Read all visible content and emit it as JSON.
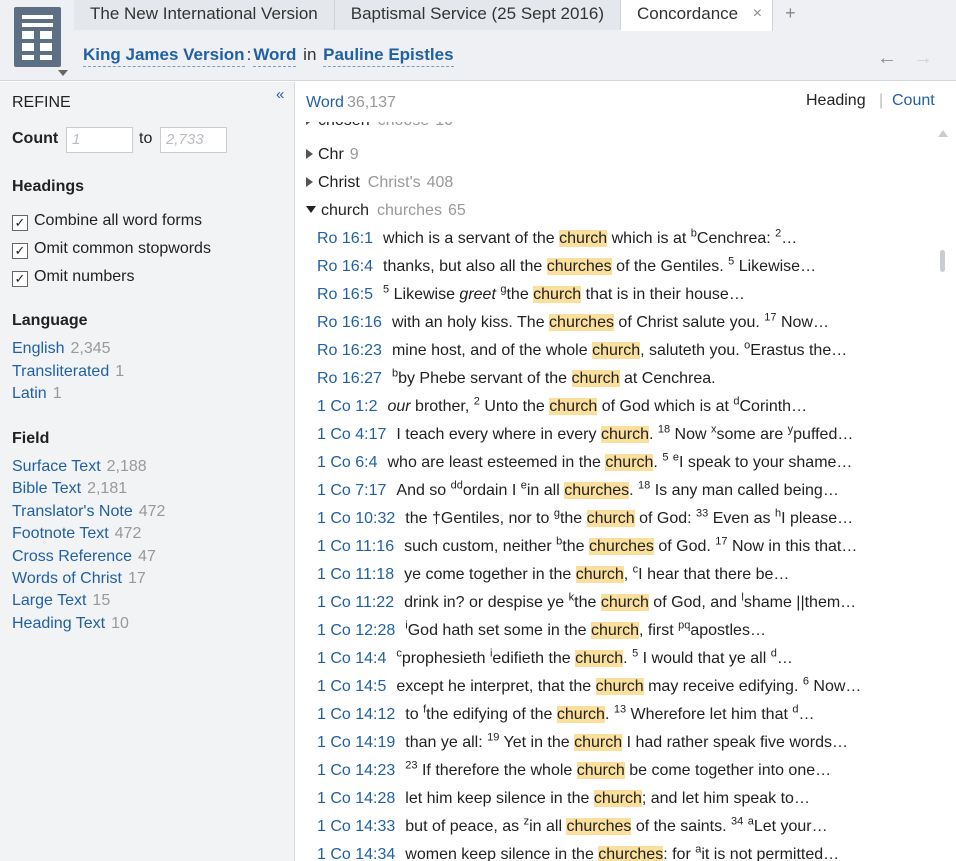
{
  "tabs": [
    {
      "label": "The New International Version"
    },
    {
      "label": "Baptismal Service (25 Sept 2016)"
    },
    {
      "label": "Concordance",
      "close": "×"
    }
  ],
  "tab_add": "+",
  "breadcrumb": {
    "version": "King James Version",
    "colon": ":",
    "field": "Word",
    "in": "in",
    "scope": "Pauline Epistles"
  },
  "nav": {
    "back": "←",
    "forward": "→"
  },
  "sidebar": {
    "collapse": "«",
    "refine": "REFINE",
    "count_label": "Count",
    "count_min_placeholder": "1",
    "count_to": "to",
    "count_max_placeholder": "2,733",
    "headings_title": "Headings",
    "checks": [
      {
        "label": "Combine all word forms",
        "checked": "✓"
      },
      {
        "label": "Omit common stopwords",
        "checked": "✓"
      },
      {
        "label": "Omit numbers",
        "checked": "✓"
      }
    ],
    "language_title": "Language",
    "languages": [
      {
        "label": "English",
        "count": "2,345"
      },
      {
        "label": "Transliterated",
        "count": "1"
      },
      {
        "label": "Latin",
        "count": "1"
      }
    ],
    "field_title": "Field",
    "fields": [
      {
        "label": "Surface Text",
        "count": "2,188"
      },
      {
        "label": "Bible Text",
        "count": "2,181"
      },
      {
        "label": "Translator's Note",
        "count": "472"
      },
      {
        "label": "Footnote Text",
        "count": "472"
      },
      {
        "label": "Cross Reference",
        "count": "47"
      },
      {
        "label": "Words of Christ",
        "count": "17"
      },
      {
        "label": "Large Text",
        "count": "15"
      },
      {
        "label": "Heading Text",
        "count": "10"
      }
    ]
  },
  "main": {
    "title": "Word",
    "total": "36,137",
    "view_heading": "Heading",
    "view_sep": "|",
    "view_count": "Count",
    "words": [
      {
        "word": "chosen",
        "form": "choose",
        "count": "10"
      },
      {
        "word": "Chr",
        "form": "",
        "count": "9"
      },
      {
        "word": "Christ",
        "form": "Christ's",
        "count": "408"
      },
      {
        "word": "church",
        "form": "churches",
        "count": "65"
      }
    ],
    "verses": [
      {
        "ref": "Ro 16:1",
        "segs": [
          {
            "t": "which is a servant of the "
          },
          {
            "t": "church",
            "h": 1
          },
          {
            "t": " which is at "
          },
          {
            "t": "b",
            "s": 1
          },
          {
            "t": "Cenchrea: "
          },
          {
            "t": "2",
            "s": 1
          },
          {
            "t": "…"
          }
        ]
      },
      {
        "ref": "Ro 16:4",
        "segs": [
          {
            "t": "thanks, but also all the "
          },
          {
            "t": "churches",
            "h": 1
          },
          {
            "t": " of the Gentiles. "
          },
          {
            "t": "5",
            "s": 1
          },
          {
            "t": " Likewise…"
          }
        ]
      },
      {
        "ref": "Ro 16:5",
        "segs": [
          {
            "t": "5",
            "s": 1
          },
          {
            "t": " Likewise "
          },
          {
            "t": "greet",
            "i": 1
          },
          {
            "t": " "
          },
          {
            "t": "g",
            "s": 1
          },
          {
            "t": "the "
          },
          {
            "t": "church",
            "h": 1
          },
          {
            "t": " that is in their house…"
          }
        ]
      },
      {
        "ref": "Ro 16:16",
        "segs": [
          {
            "t": "with an holy kiss. The "
          },
          {
            "t": "churches",
            "h": 1
          },
          {
            "t": " of Christ salute you. "
          },
          {
            "t": "17",
            "s": 1
          },
          {
            "t": " Now…"
          }
        ]
      },
      {
        "ref": "Ro 16:23",
        "segs": [
          {
            "t": "mine host, and of the whole "
          },
          {
            "t": "church",
            "h": 1
          },
          {
            "t": ", saluteth you. "
          },
          {
            "t": "o",
            "s": 1
          },
          {
            "t": "Erastus the…"
          }
        ]
      },
      {
        "ref": "Ro 16:27",
        "segs": [
          {
            "t": "b",
            "s": 1
          },
          {
            "t": "by Phebe servant of the "
          },
          {
            "t": "church",
            "h": 1
          },
          {
            "t": " at Cenchrea."
          }
        ]
      },
      {
        "ref": "1 Co 1:2",
        "segs": [
          {
            "t": "our",
            "i": 1
          },
          {
            "t": " brother, "
          },
          {
            "t": "2",
            "s": 1
          },
          {
            "t": " Unto the "
          },
          {
            "t": "church",
            "h": 1
          },
          {
            "t": " of God which is at "
          },
          {
            "t": "d",
            "s": 1
          },
          {
            "t": "Corinth…"
          }
        ]
      },
      {
        "ref": "1 Co 4:17",
        "segs": [
          {
            "t": "I teach every where in every "
          },
          {
            "t": "church",
            "h": 1
          },
          {
            "t": ". "
          },
          {
            "t": "18",
            "s": 1
          },
          {
            "t": " Now "
          },
          {
            "t": "x",
            "s": 1
          },
          {
            "t": "some are "
          },
          {
            "t": "y",
            "s": 1
          },
          {
            "t": "puffed…"
          }
        ]
      },
      {
        "ref": "1 Co 6:4",
        "segs": [
          {
            "t": "who are least esteemed in the "
          },
          {
            "t": "church",
            "h": 1
          },
          {
            "t": ". "
          },
          {
            "t": "5",
            "s": 1
          },
          {
            "t": " "
          },
          {
            "t": "e",
            "s": 1
          },
          {
            "t": "I speak to your shame…"
          }
        ]
      },
      {
        "ref": "1 Co 7:17",
        "segs": [
          {
            "t": "And so "
          },
          {
            "t": "dd",
            "s": 1
          },
          {
            "t": "ordain I "
          },
          {
            "t": "e",
            "s": 1
          },
          {
            "t": "in all "
          },
          {
            "t": "churches",
            "h": 1
          },
          {
            "t": ". "
          },
          {
            "t": "18",
            "s": 1
          },
          {
            "t": " Is any man called being…"
          }
        ]
      },
      {
        "ref": "1 Co 10:32",
        "segs": [
          {
            "t": "the †Gentiles, nor to "
          },
          {
            "t": "g",
            "s": 1
          },
          {
            "t": "the "
          },
          {
            "t": "church",
            "h": 1
          },
          {
            "t": " of God: "
          },
          {
            "t": "33",
            "s": 1
          },
          {
            "t": " Even as "
          },
          {
            "t": "h",
            "s": 1
          },
          {
            "t": "I please…"
          }
        ]
      },
      {
        "ref": "1 Co 11:16",
        "segs": [
          {
            "t": "such custom, neither "
          },
          {
            "t": "b",
            "s": 1
          },
          {
            "t": "the "
          },
          {
            "t": "churches",
            "h": 1
          },
          {
            "t": " of God. "
          },
          {
            "t": "17",
            "s": 1
          },
          {
            "t": " Now in this that…"
          }
        ]
      },
      {
        "ref": "1 Co 11:18",
        "segs": [
          {
            "t": "ye come together in the "
          },
          {
            "t": "church",
            "h": 1
          },
          {
            "t": ", "
          },
          {
            "t": "c",
            "s": 1
          },
          {
            "t": "I hear that there be…"
          }
        ]
      },
      {
        "ref": "1 Co 11:22",
        "segs": [
          {
            "t": "drink in? or despise ye "
          },
          {
            "t": "k",
            "s": 1
          },
          {
            "t": "the "
          },
          {
            "t": "church",
            "h": 1
          },
          {
            "t": " of God, and "
          },
          {
            "t": "l",
            "s": 1
          },
          {
            "t": "shame ||them…"
          }
        ]
      },
      {
        "ref": "1 Co 12:28",
        "segs": [
          {
            "t": "i",
            "s": 1
          },
          {
            "t": "God hath set some in the "
          },
          {
            "t": "church",
            "h": 1
          },
          {
            "t": ", first "
          },
          {
            "t": "pq",
            "s": 1
          },
          {
            "t": "apostles…"
          }
        ]
      },
      {
        "ref": "1 Co 14:4",
        "segs": [
          {
            "t": "c",
            "s": 1
          },
          {
            "t": "prophesieth "
          },
          {
            "t": "i",
            "s": 1
          },
          {
            "t": "edifieth the "
          },
          {
            "t": "church",
            "h": 1
          },
          {
            "t": ". "
          },
          {
            "t": "5",
            "s": 1
          },
          {
            "t": " I would that ye all "
          },
          {
            "t": "d",
            "s": 1
          },
          {
            "t": "…"
          }
        ]
      },
      {
        "ref": "1 Co 14:5",
        "segs": [
          {
            "t": "except he interpret, that the "
          },
          {
            "t": "church",
            "h": 1
          },
          {
            "t": " may receive edifying. "
          },
          {
            "t": "6",
            "s": 1
          },
          {
            "t": " Now…"
          }
        ]
      },
      {
        "ref": "1 Co 14:12",
        "segs": [
          {
            "t": "to "
          },
          {
            "t": "f",
            "s": 1
          },
          {
            "t": "the edifying of the "
          },
          {
            "t": "church",
            "h": 1
          },
          {
            "t": ". "
          },
          {
            "t": "13",
            "s": 1
          },
          {
            "t": " Wherefore let him that "
          },
          {
            "t": "d",
            "s": 1
          },
          {
            "t": "…"
          }
        ]
      },
      {
        "ref": "1 Co 14:19",
        "segs": [
          {
            "t": "than ye all: "
          },
          {
            "t": "19",
            "s": 1
          },
          {
            "t": " Yet in the "
          },
          {
            "t": "church",
            "h": 1
          },
          {
            "t": " I had rather speak five words…"
          }
        ]
      },
      {
        "ref": "1 Co 14:23",
        "segs": [
          {
            "t": "23",
            "s": 1
          },
          {
            "t": " If therefore the whole "
          },
          {
            "t": "church",
            "h": 1
          },
          {
            "t": " be come together into one…"
          }
        ]
      },
      {
        "ref": "1 Co 14:28",
        "segs": [
          {
            "t": "let him keep silence in the "
          },
          {
            "t": "church",
            "h": 1
          },
          {
            "t": "; and let him speak to…"
          }
        ]
      },
      {
        "ref": "1 Co 14:33",
        "segs": [
          {
            "t": "but of peace, as "
          },
          {
            "t": "z",
            "s": 1
          },
          {
            "t": "in all "
          },
          {
            "t": "churches",
            "h": 1
          },
          {
            "t": " of the saints. "
          },
          {
            "t": "34",
            "s": 1
          },
          {
            "t": " "
          },
          {
            "t": "a",
            "s": 1
          },
          {
            "t": "Let your…"
          }
        ]
      },
      {
        "ref": "1 Co 14:34",
        "segs": [
          {
            "t": "women keep silence in the "
          },
          {
            "t": "churches",
            "h": 1
          },
          {
            "t": ": for "
          },
          {
            "t": "a",
            "s": 1
          },
          {
            "t": "it is not permitted…"
          }
        ]
      }
    ]
  }
}
